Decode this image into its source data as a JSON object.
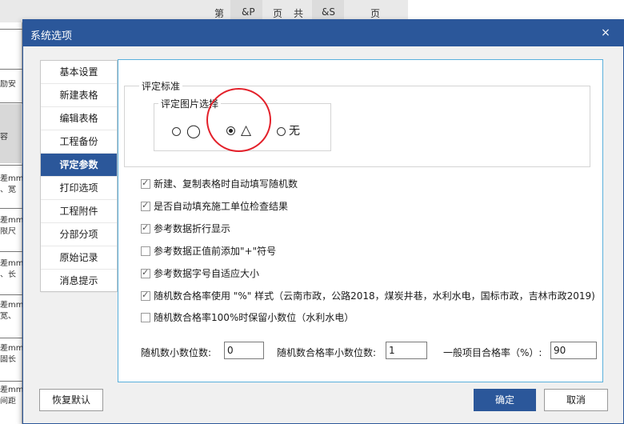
{
  "background": {
    "top_texts": [
      "第",
      "&P",
      "页",
      "共",
      "&S",
      "页"
    ],
    "left_texts": [
      "励安",
      "容",
      "差mm",
      "、宽",
      "差mm",
      "限尺",
      "差mm",
      "、长",
      "差mm",
      "宽、",
      "差mm",
      "固长",
      "差mm",
      "间距"
    ]
  },
  "dialog": {
    "title": "系统选项",
    "close_glyph": "×"
  },
  "nav": {
    "items": [
      {
        "label": "基本设置"
      },
      {
        "label": "新建表格"
      },
      {
        "label": "编辑表格"
      },
      {
        "label": "工程备份"
      },
      {
        "label": "评定参数"
      },
      {
        "label": "打印选项"
      },
      {
        "label": "工程附件"
      },
      {
        "label": "分部分项"
      },
      {
        "label": "原始记录"
      },
      {
        "label": "消息提示"
      }
    ],
    "active_index": 4
  },
  "criteria": {
    "group_title": "评定标准",
    "image_group_title": "评定图片选择",
    "options": [
      {
        "glyph": "◯",
        "selected": false
      },
      {
        "glyph": "△",
        "selected": true
      },
      {
        "glyph": "无",
        "selected": false
      }
    ]
  },
  "checkboxes": [
    {
      "label": "新建、复制表格时自动填写随机数",
      "checked": true
    },
    {
      "label": "是否自动填充施工单位检查结果",
      "checked": true
    },
    {
      "label": "参考数据折行显示",
      "checked": true
    },
    {
      "label": "参考数据正值前添加\"+\"符号",
      "checked": false
    },
    {
      "label": "参考数据字号自适应大小",
      "checked": true
    },
    {
      "label": "随机数合格率使用 \"%\" 样式（云南市政，公路2018，煤炭井巷，水利水电，国标市政，吉林市政2019)",
      "checked": true
    },
    {
      "label": "随机数合格率100%时保留小数位（水利水电）",
      "checked": false
    }
  ],
  "fields": {
    "random_decimals": {
      "label": "随机数小数位数:",
      "value": "0"
    },
    "pass_rate_decimals": {
      "label": "随机数合格率小数位数:",
      "value": "1"
    },
    "general_pass_rate": {
      "label": "一般项目合格率（%）:",
      "value": "90"
    }
  },
  "buttons": {
    "restore_defaults": "恢复默认",
    "ok": "确定",
    "cancel": "取消"
  },
  "colors": {
    "accent": "#2b579a",
    "panel_border": "#5ab0dc",
    "annotation": "#e3202a"
  }
}
